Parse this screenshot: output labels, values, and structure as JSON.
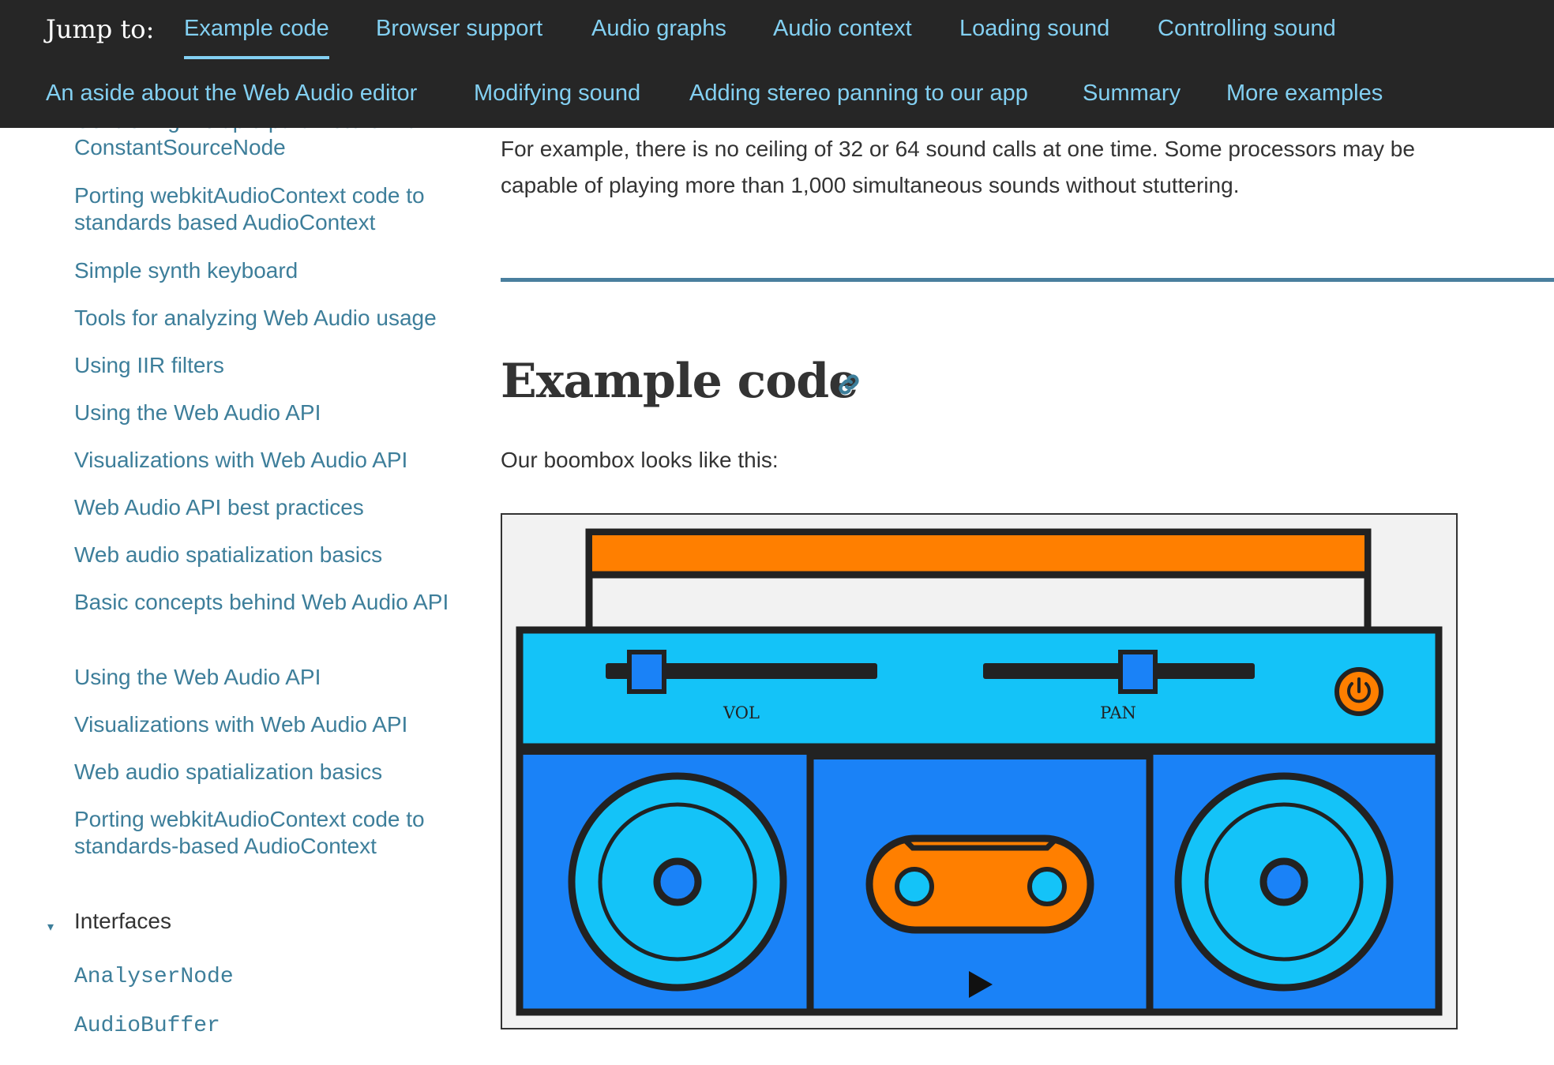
{
  "jump": {
    "label": "Jump to:",
    "links": [
      "Example code",
      "Browser support",
      "Audio graphs",
      "Audio context",
      "Loading sound",
      "Controlling sound",
      "An aside about the Web Audio editor",
      "Modifying sound",
      "Adding stereo panning to our app",
      "Summary",
      "More examples"
    ],
    "active_index": 0
  },
  "sidebar": {
    "items": [
      "Controlling multiple parameters with ConstantSourceNode",
      "Porting webkitAudioContext code to standards based AudioContext",
      "Simple synth keyboard",
      "Tools for analyzing Web Audio usage",
      "Using IIR filters",
      "Using the Web Audio API",
      "Visualizations with Web Audio API",
      "Web Audio API best practices",
      "Web audio spatialization basics",
      "Basic concepts behind Web Audio API",
      "Using the Web Audio API",
      "Visualizations with Web Audio API",
      "Web audio spatialization basics",
      "Porting webkitAudioContext code to standards-based AudioContext"
    ],
    "section_toggle": "▾",
    "section_title": "Interfaces",
    "interfaces": [
      "AnalyserNode",
      "AudioBuffer"
    ]
  },
  "main": {
    "intro_text": "For example, there is no ceiling of 32 or 64 sound calls at one time. Some processors may be capable of playing more than 1,000 simultaneous sounds without stuttering.",
    "heading": "Example code",
    "lead_text": "Our boombox looks like this:"
  },
  "boombox": {
    "vol_label": "VOL",
    "pan_label": "PAN",
    "colors": {
      "handle": "#ff7f00",
      "top_panel": "#14c3f8",
      "body": "#1a82f7",
      "outline": "#222222",
      "background": "#f2f2f2"
    },
    "vol_level": 0.1,
    "pan_level": 0.58
  },
  "colors": {
    "jumpbar_bg": "#262626",
    "jump_link": "#83d0f2",
    "sidebar_link": "#3d7e9a",
    "rule": "#4a7f9e"
  }
}
